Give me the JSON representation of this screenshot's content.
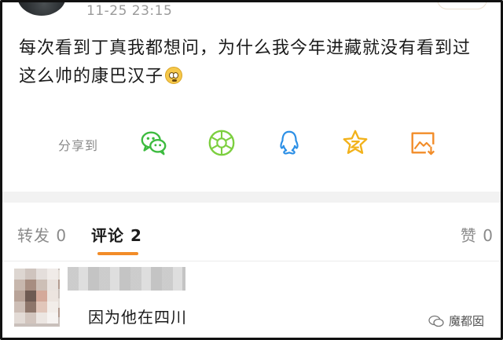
{
  "post": {
    "timestamp": "11-25 23:15",
    "text_line1": "每次看到丁真我都想问，为什么我今年进藏就没有看到过",
    "text_line2": "这么帅的康巴汉子",
    "emoji_icon": "crying-face-emoji"
  },
  "share": {
    "label": "分享到",
    "targets": [
      {
        "name": "wechat-icon",
        "color": "#3dbb3f"
      },
      {
        "name": "moments-icon",
        "color": "#7ccf3f"
      },
      {
        "name": "qq-icon",
        "color": "#2b8fe6"
      },
      {
        "name": "qzone-icon",
        "color": "#f2b21b"
      },
      {
        "name": "save-image-icon",
        "color": "#f28c28"
      }
    ]
  },
  "tabs": {
    "repost": "转发 0",
    "comments": "评论 2",
    "likes": "赞 0",
    "active_color": "#f28c28"
  },
  "comment": {
    "text": "因为他在四川"
  },
  "watermark": {
    "text": "魔都囡"
  }
}
